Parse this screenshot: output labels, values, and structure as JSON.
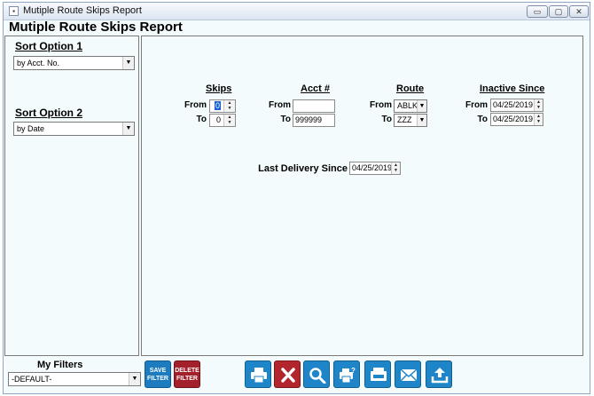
{
  "window": {
    "title": "Mutiple Route Skips Report",
    "controls": {
      "minimize": "▭",
      "maximize": "▢",
      "close": "✕"
    }
  },
  "app": {
    "title": "Mutiple Route Skips Report"
  },
  "sort_option_1": {
    "label": "Sort Option 1",
    "value": "by Acct. No."
  },
  "sort_option_2": {
    "label": "Sort Option 2",
    "value": "by Date"
  },
  "skips": {
    "header": "Skips",
    "from_label": "From",
    "from_value": "0",
    "to_label": "To",
    "to_value": "0"
  },
  "acct": {
    "header": "Acct #",
    "from_label": "From",
    "from_value": "",
    "to_label": "To",
    "to_value": "999999"
  },
  "route": {
    "header": "Route",
    "from_label": "From",
    "from_value": "ABLK",
    "to_label": "To",
    "to_value": "ZZZ"
  },
  "inactive": {
    "header": "Inactive Since",
    "from_label": "From",
    "from_value": "04/25/2019",
    "to_label": "To",
    "to_value": "04/25/2019"
  },
  "last_delivery": {
    "label": "Last Delivery Since",
    "value": "04/25/2019"
  },
  "filters": {
    "label": "My Filters",
    "value": "-DEFAULT-"
  },
  "buttons": {
    "save_line1": "SAVE",
    "save_line2": "FILTER",
    "delete_line1": "DELETE",
    "delete_line2": "FILTER",
    "toolbar_icons": [
      "printer-icon",
      "cancel-x-icon",
      "magnifier-icon",
      "print-options-icon",
      "fax-printer-icon",
      "email-icon",
      "export-upload-icon"
    ]
  },
  "colors": {
    "accent_blue": "#1e85c9",
    "danger_red": "#b3252d",
    "panel_bg": "#f4fbfd",
    "selection": "#1560d8"
  }
}
